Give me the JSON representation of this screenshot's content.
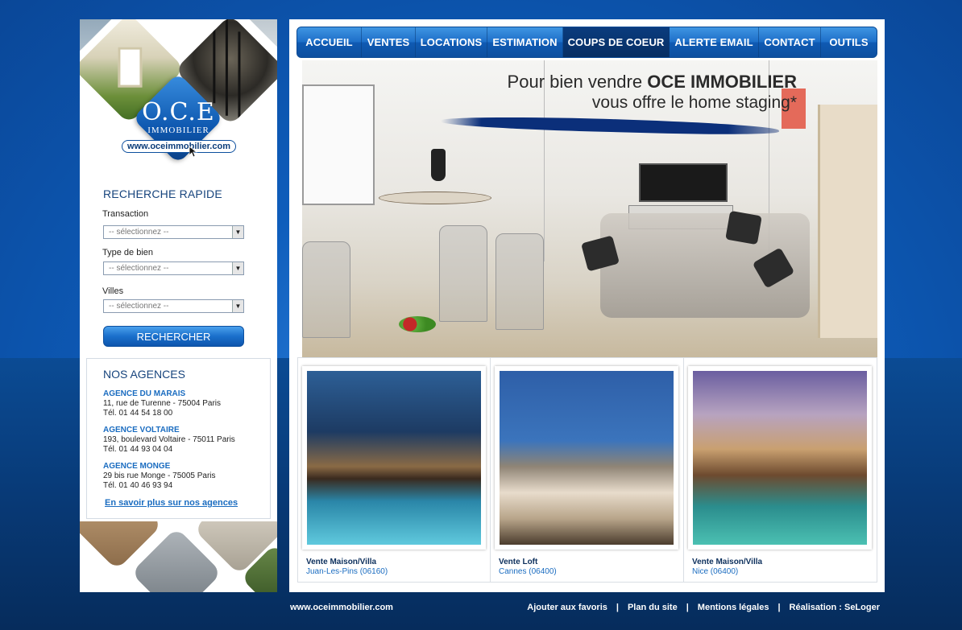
{
  "logo": {
    "name": "O.C.E",
    "subtitle": "IMMOBILIER",
    "url": "www.oceimmobilier.com"
  },
  "search": {
    "title": "RECHERCHE RAPIDE",
    "fields": [
      {
        "label": "Transaction",
        "value": "-- sélectionnez --"
      },
      {
        "label": "Type de bien",
        "value": "-- sélectionnez --"
      },
      {
        "label": "Villes",
        "value": "-- sélectionnez --"
      }
    ],
    "button": "RECHERCHER"
  },
  "agencies": {
    "title": "NOS AGENCES",
    "items": [
      {
        "name": "AGENCE DU MARAIS",
        "address": "11, rue de Turenne - 75004 Paris",
        "phone": "Tél. 01 44 54 18 00"
      },
      {
        "name": "AGENCE VOLTAIRE",
        "address": "193, boulevard Voltaire - 75011 Paris",
        "phone": "Tél. 01 44 93 04 04"
      },
      {
        "name": "AGENCE MONGE",
        "address": "29 bis rue Monge - 75005 Paris",
        "phone": "Tél. 01 40 46 93 94"
      }
    ],
    "more_link": "En savoir plus sur nos agences"
  },
  "nav": {
    "items": [
      "ACCUEIL",
      "VENTES",
      "LOCATIONS",
      "ESTIMATION",
      "COUPS DE COEUR",
      "ALERTE EMAIL",
      "CONTACT",
      "OUTILS"
    ],
    "active": "COUPS DE COEUR"
  },
  "hero": {
    "line1_prefix": "Pour bien vendre ",
    "line1_brand": "OCE IMMOBILIER",
    "line2": "vous offre le home staging*"
  },
  "listings": [
    {
      "type": "Vente Maison/Villa",
      "location": "Juan-Les-Pins (06160)"
    },
    {
      "type": "Vente Loft",
      "location": "Cannes (06400)"
    },
    {
      "type": "Vente Maison/Villa",
      "location": "Nice (06400)"
    }
  ],
  "footer": {
    "url": "www.oceimmobilier.com",
    "links": [
      "Ajouter aux favoris",
      "Plan du site",
      "Mentions légales",
      "Réalisation : SeLoger"
    ]
  },
  "colors": {
    "accent": "#0d5bb8",
    "nav_active": "#072e63",
    "link": "#1a6cc0",
    "heading": "#17447d"
  }
}
